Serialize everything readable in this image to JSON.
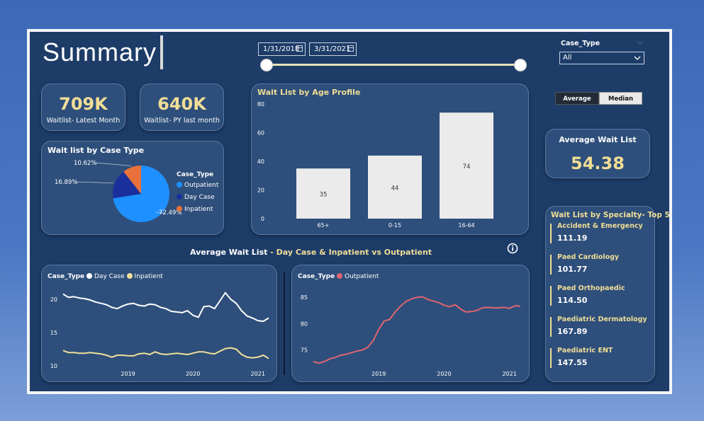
{
  "page": {
    "title": "Summary"
  },
  "filters": {
    "date_start": "1/31/2018",
    "date_end": "3/31/2021",
    "case_type_label": "Case_Type",
    "case_type_value": "All"
  },
  "toggle": {
    "average_label": "Average",
    "median_label": "Median",
    "selected": "Average"
  },
  "kpis": [
    {
      "value": "709K",
      "label": "Waitlist- Latest Month"
    },
    {
      "value": "640K",
      "label": "Waitlist- PY last month"
    }
  ],
  "avg_wait_card": {
    "title": "Average Wait List",
    "value": "54.38"
  },
  "pie": {
    "title": "Wait list by Case Type",
    "legend_title": "Case_Type",
    "colors": {
      "Outpatient": "#1e90ff",
      "Day Case": "#1a2f9c",
      "Inpatient": "#e8713c"
    }
  },
  "bar": {
    "title": "Wait List by Age Profile"
  },
  "line_section_title": {
    "part1": "Average Wait List",
    "part2": " - Day Case & Inpatient vs Outpatient"
  },
  "line_left": {
    "legend_title": "Case_Type",
    "series_names": [
      "Day Case",
      "Inpatient"
    ],
    "colors": [
      "#ffffff",
      "#efe19a"
    ]
  },
  "line_right": {
    "legend_title": "Case_Type",
    "series_names": [
      "Outpatient"
    ],
    "colors": [
      "#e06470"
    ]
  },
  "specialty": {
    "title": "Wait List by Specialty- Top 5",
    "items": [
      {
        "name": "Accident & Emergency",
        "value": "111.19"
      },
      {
        "name": "Paed Cardiology",
        "value": "101.77"
      },
      {
        "name": "Paed Orthopaedic",
        "value": "114.50"
      },
      {
        "name": "Paediatric Dermatology",
        "value": "167.89"
      },
      {
        "name": "Paediatric ENT",
        "value": "147.55"
      }
    ]
  },
  "info_icon": "info-icon",
  "chart_data": [
    {
      "type": "pie",
      "title": "Wait list by Case Type",
      "categories": [
        "Outpatient",
        "Day Case",
        "Inpatient"
      ],
      "values": [
        72.49,
        16.89,
        10.62
      ],
      "labels": [
        "72.49%",
        "16.89%",
        "10.62%"
      ],
      "legend": "right"
    },
    {
      "type": "bar",
      "title": "Wait List by Age Profile",
      "categories": [
        "65+",
        "0-15",
        "16-64"
      ],
      "values": [
        35,
        44,
        74
      ],
      "ylim": [
        0,
        80
      ],
      "yticks": [
        0,
        20,
        40,
        60,
        80
      ],
      "grid": false
    },
    {
      "type": "line",
      "x_ticks": [
        "2019",
        "2020",
        "2021"
      ],
      "yticks": [
        10,
        15,
        20
      ],
      "ylim": [
        10,
        21.5
      ],
      "x": [
        "2018-01",
        "2018-02",
        "2018-03",
        "2018-04",
        "2018-05",
        "2018-06",
        "2018-07",
        "2018-08",
        "2018-09",
        "2018-10",
        "2018-11",
        "2018-12",
        "2019-01",
        "2019-02",
        "2019-03",
        "2019-04",
        "2019-05",
        "2019-06",
        "2019-07",
        "2019-08",
        "2019-09",
        "2019-10",
        "2019-11",
        "2019-12",
        "2020-01",
        "2020-02",
        "2020-03",
        "2020-04",
        "2020-05",
        "2020-06",
        "2020-07",
        "2020-08",
        "2020-09",
        "2020-10",
        "2020-11",
        "2020-12",
        "2021-01",
        "2021-02",
        "2021-03"
      ],
      "series": [
        {
          "name": "Day Case",
          "values": [
            20.8,
            20.3,
            20.4,
            20.2,
            20.1,
            19.9,
            19.6,
            19.4,
            19.2,
            18.8,
            18.6,
            19.0,
            19.3,
            19.4,
            19.1,
            19.0,
            19.3,
            19.2,
            18.8,
            18.6,
            18.2,
            18.1,
            18.0,
            18.3,
            17.6,
            17.3,
            18.9,
            19.0,
            18.6,
            19.8,
            21.0,
            20.0,
            19.4,
            18.3,
            17.5,
            17.2,
            16.8,
            16.7,
            17.2
          ]
        },
        {
          "name": "Inpatient",
          "values": [
            12.3,
            12.0,
            12.0,
            11.9,
            11.9,
            12.0,
            11.9,
            11.8,
            11.6,
            11.3,
            11.6,
            11.6,
            11.5,
            11.5,
            11.8,
            11.9,
            11.7,
            12.1,
            11.8,
            11.7,
            11.8,
            11.9,
            11.8,
            11.7,
            11.9,
            12.1,
            12.1,
            11.9,
            11.8,
            12.2,
            12.6,
            12.7,
            12.5,
            11.7,
            11.3,
            11.2,
            11.3,
            11.6,
            11.1
          ]
        }
      ]
    },
    {
      "type": "line",
      "x_ticks": [
        "2019",
        "2020",
        "2021"
      ],
      "yticks": [
        75,
        80,
        85
      ],
      "ylim": [
        72,
        86.5
      ],
      "x": [
        "2018-01",
        "2018-02",
        "2018-03",
        "2018-04",
        "2018-05",
        "2018-06",
        "2018-07",
        "2018-08",
        "2018-09",
        "2018-10",
        "2018-11",
        "2018-12",
        "2019-01",
        "2019-02",
        "2019-03",
        "2019-04",
        "2019-05",
        "2019-06",
        "2019-07",
        "2019-08",
        "2019-09",
        "2019-10",
        "2019-11",
        "2019-12",
        "2020-01",
        "2020-02",
        "2020-03",
        "2020-04",
        "2020-05",
        "2020-06",
        "2020-07",
        "2020-08",
        "2020-09",
        "2020-10",
        "2020-11",
        "2020-12",
        "2021-01",
        "2021-02",
        "2021-03"
      ],
      "series": [
        {
          "name": "Outpatient",
          "values": [
            72.8,
            72.5,
            72.8,
            73.3,
            73.6,
            74.0,
            74.2,
            74.5,
            74.8,
            75.0,
            75.5,
            76.8,
            78.9,
            80.5,
            80.8,
            82.2,
            83.3,
            84.2,
            84.7,
            85.0,
            85.1,
            84.6,
            84.3,
            84.0,
            83.5,
            83.2,
            83.6,
            82.8,
            82.2,
            82.3,
            82.5,
            83.0,
            83.1,
            83.0,
            83.0,
            83.1,
            82.9,
            83.4,
            83.3
          ]
        }
      ]
    }
  ]
}
